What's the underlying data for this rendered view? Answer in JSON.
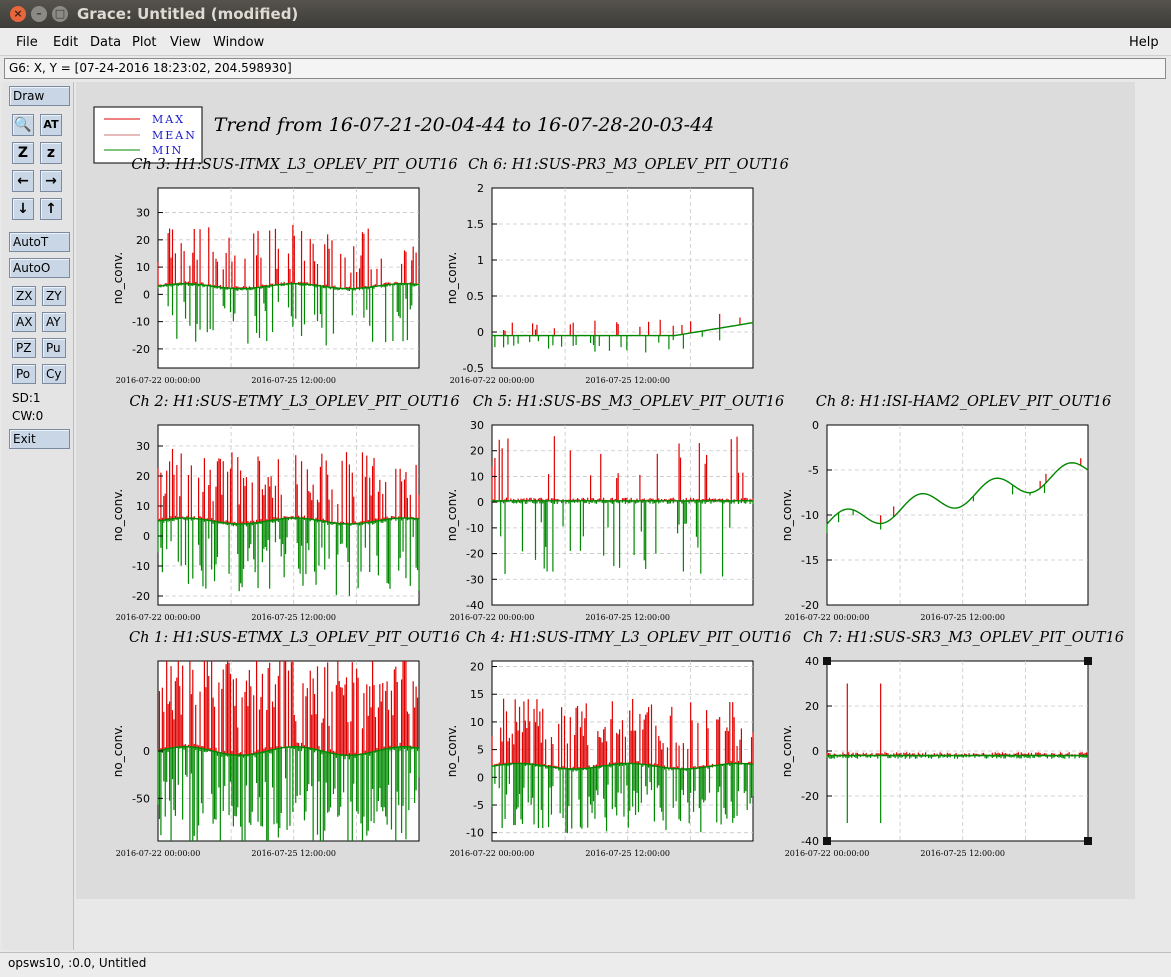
{
  "window": {
    "title": "Grace: Untitled (modified)",
    "close_glyph": "×",
    "min_glyph": "–",
    "max_glyph": "□"
  },
  "menu": {
    "file": "File",
    "edit": "Edit",
    "data": "Data",
    "plot": "Plot",
    "view": "View",
    "window": "Window",
    "help": "Help"
  },
  "locator": "G6: X, Y = [07-24-2016 18:23:02, 204.598930]",
  "toolbar": {
    "draw": "Draw",
    "autot": "AutoT",
    "autoo": "AutoO",
    "zx": "ZX",
    "zy": "ZY",
    "ax": "AX",
    "ay": "AY",
    "pz": "PZ",
    "pu": "Pu",
    "po": "Po",
    "cy": "Cy",
    "sd": "SD:1",
    "cw": "CW:0",
    "exit": "Exit",
    "icons": {
      "zoom": "🔍",
      "text": "AT",
      "z_big": "Z",
      "z_small": "z",
      "left": "←",
      "right": "→",
      "down": "↓",
      "up": "↑"
    }
  },
  "plot": {
    "title": "Trend from 16-07-21-20-04-44 to 16-07-28-20-03-44",
    "legend": [
      "MAX",
      "MEAN",
      "MIN"
    ],
    "ylabel": "no_conv.",
    "xtick_labels": [
      "2016-07-22 00:00:00",
      "2016-07-25 12:00:00"
    ],
    "colors": {
      "max": "#e00000",
      "mean": "#cc7777",
      "min": "#008800",
      "legend_text": "#1a1acc"
    },
    "panels": [
      {
        "id": "g3",
        "title": "Ch 3: H1:SUS-ITMX_L3_OPLEV_PIT_OUT16",
        "yticks": [
          "30",
          "20",
          "10",
          "0",
          "-10",
          "-20"
        ]
      },
      {
        "id": "g6",
        "title": "Ch 6: H1:SUS-PR3_M3_OPLEV_PIT_OUT16",
        "yticks": [
          "2",
          "1.5",
          "1",
          "0.5",
          "0",
          "-0.5"
        ]
      },
      {
        "id": "g2",
        "title": "Ch 2: H1:SUS-ETMY_L3_OPLEV_PIT_OUT16",
        "yticks": [
          "30",
          "20",
          "10",
          "0",
          "-10",
          "-20"
        ]
      },
      {
        "id": "g5",
        "title": "Ch 5: H1:SUS-BS_M3_OPLEV_PIT_OUT16",
        "yticks": [
          "30",
          "20",
          "10",
          "0",
          "-10",
          "-20",
          "-30",
          "-40"
        ]
      },
      {
        "id": "g8",
        "title": "Ch 8: H1:ISI-HAM2_OPLEV_PIT_OUT16",
        "yticks": [
          "0",
          "-5",
          "-10",
          "-15",
          "-20"
        ]
      },
      {
        "id": "g1",
        "title": "Ch 1: H1:SUS-ETMX_L3_OPLEV_PIT_OUT16",
        "yticks": [
          "0",
          "-50"
        ]
      },
      {
        "id": "g4",
        "title": "Ch 4: H1:SUS-ITMY_L3_OPLEV_PIT_OUT16",
        "yticks": [
          "20",
          "15",
          "10",
          "5",
          "0",
          "-5",
          "-10"
        ]
      },
      {
        "id": "g7",
        "title": "Ch 7: H1:SUS-SR3_M3_OPLEV_PIT_OUT16",
        "yticks": [
          "40",
          "20",
          "0",
          "-20",
          "-40"
        ]
      }
    ]
  },
  "status": "opsws10, :0.0, Untitled"
}
